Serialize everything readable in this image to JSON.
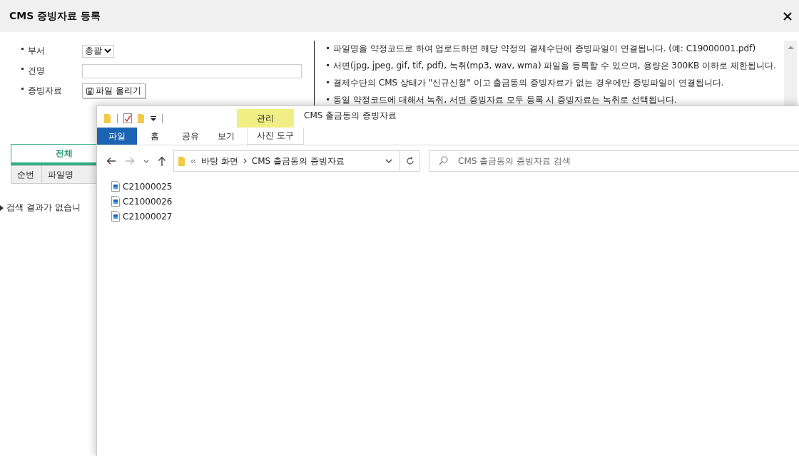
{
  "dialog": {
    "title": "CMS 증빙자료 등록"
  },
  "form": {
    "fields": [
      {
        "kind": "select",
        "label": "부서",
        "value": "총괄"
      },
      {
        "kind": "text",
        "label": "건명"
      },
      {
        "kind": "file",
        "label": "증빙자료",
        "button": "파일 올리기"
      }
    ]
  },
  "notes": [
    "파일명을 약정코드로 하여 업로드하면 해당 약정의 결제수단에 증빙파일이 연결됩니다. (예: C19000001.pdf)",
    "서면(jpg, jpeg, gif, tif, pdf), 녹취(mp3, wav, wma) 파일을 등록할 수 있으며, 용량은 300KB 이하로 제한됩니다.",
    "결제수단의 CMS 상태가 \"신규신청\" 이고 출금동의 증빙자료가 없는 경우에만 증빙파일이 연결됩니다.",
    "동일 약정코드에 대해서 녹취, 서면 증빙자료 모두 등록 시 증빙자료는 녹취로 선택됩니다."
  ],
  "tabs": [
    {
      "label": "전체",
      "selected": true
    }
  ],
  "table": {
    "columns": [
      "순번",
      "파일명"
    ],
    "empty_message": "검색 결과가 없습니"
  },
  "explorer": {
    "title": "CMS 출금동의 증빙자료",
    "context_tab": {
      "group": "관리",
      "label": "사진 도구"
    },
    "ribbon_tabs": [
      {
        "label": "파일",
        "selected": true
      },
      {
        "label": "홈",
        "selected": false
      },
      {
        "label": "공유",
        "selected": false
      },
      {
        "label": "보기",
        "selected": false
      }
    ],
    "breadcrumb": [
      "바탕 화면",
      "CMS 출금동의 증빙자료"
    ],
    "search": {
      "placeholder": "CMS 출금동의 증빙자료 검색"
    },
    "files": [
      {
        "name": "C21000025"
      },
      {
        "name": "C21000026"
      },
      {
        "name": "C21000027"
      }
    ]
  }
}
